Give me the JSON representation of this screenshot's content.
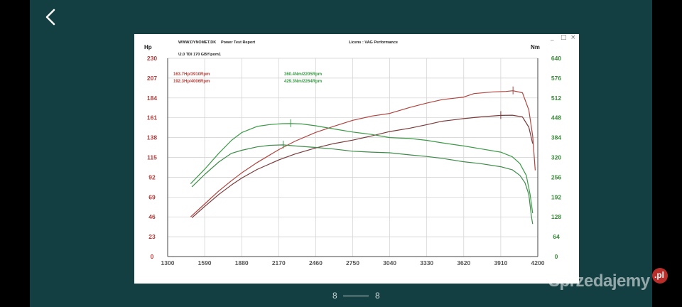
{
  "pager": {
    "current": "8",
    "total": "8"
  },
  "watermark": {
    "brand": "Sprzedajemy",
    "suffix": ".pl"
  },
  "window_controls": {
    "minimize": "_",
    "maximize": "□",
    "close": "×"
  },
  "report": {
    "site": "WWW.DYNOMET.DK",
    "report_title": "Power Test Report",
    "licence": "Licens :  VAG Performance",
    "run_name": "\\2.0 TDI 170 GBY\\pom1"
  },
  "colors": {
    "red": "#b0443e",
    "darkred": "#7a3a3a",
    "green": "#3a9a45",
    "green2": "#3c8c47",
    "axis_left": "#b33a3a",
    "axis_right": "#3a8a3a"
  },
  "chart_data": {
    "type": "line",
    "title": "",
    "xlabel": "",
    "y_left_label": "Hp",
    "y_right_label": "Nm",
    "xlim": [
      1300,
      4200
    ],
    "x_ticks": [
      1300,
      1590,
      1880,
      2170,
      2460,
      2750,
      3040,
      3330,
      3620,
      3910,
      4200
    ],
    "y_left_lim": [
      0,
      230
    ],
    "y_left_ticks": [
      0,
      23,
      46,
      69,
      92,
      115,
      138,
      161,
      184,
      207,
      230
    ],
    "y_right_lim": [
      0,
      640
    ],
    "y_right_ticks": [
      0,
      64,
      128,
      192,
      256,
      320,
      384,
      448,
      512,
      576,
      640
    ],
    "grid": true,
    "annotations": [
      {
        "text": "163.7Hp/3910Rpm",
        "color": "#b0443e"
      },
      {
        "text": "192.3Hp/4006Rpm",
        "color": "#b0443e"
      },
      {
        "text": "360.4Nm/2205Rpm",
        "color": "#3a9a45"
      },
      {
        "text": "429.3Nm/2264Rpm",
        "color": "#3a9a45"
      }
    ],
    "series": [
      {
        "axis": "left",
        "color": "#b0443e",
        "peak_marker": [
          4006,
          192.3
        ],
        "points": [
          [
            1480,
            46
          ],
          [
            1590,
            61
          ],
          [
            1700,
            76
          ],
          [
            1800,
            88
          ],
          [
            1880,
            97
          ],
          [
            2000,
            109
          ],
          [
            2170,
            124
          ],
          [
            2300,
            134
          ],
          [
            2460,
            144
          ],
          [
            2600,
            151
          ],
          [
            2750,
            158
          ],
          [
            2900,
            163
          ],
          [
            3040,
            166
          ],
          [
            3200,
            173
          ],
          [
            3330,
            178
          ],
          [
            3450,
            182
          ],
          [
            3620,
            185
          ],
          [
            3700,
            189
          ],
          [
            3850,
            191
          ],
          [
            3950,
            191.5
          ],
          [
            4006,
            192.3
          ],
          [
            4080,
            190
          ],
          [
            4130,
            170
          ],
          [
            4160,
            140
          ],
          [
            4180,
            100
          ]
        ]
      },
      {
        "axis": "left",
        "color": "#7a3a3a",
        "peak_marker": [
          3910,
          163.7
        ],
        "points": [
          [
            1490,
            45
          ],
          [
            1590,
            58
          ],
          [
            1700,
            72
          ],
          [
            1800,
            83
          ],
          [
            1880,
            91
          ],
          [
            2000,
            101
          ],
          [
            2170,
            112
          ],
          [
            2300,
            119
          ],
          [
            2460,
            126
          ],
          [
            2600,
            131
          ],
          [
            2750,
            135
          ],
          [
            2900,
            140
          ],
          [
            3040,
            145
          ],
          [
            3200,
            149
          ],
          [
            3330,
            153
          ],
          [
            3450,
            157
          ],
          [
            3620,
            160
          ],
          [
            3750,
            162
          ],
          [
            3910,
            163.7
          ],
          [
            4000,
            164
          ],
          [
            4080,
            162
          ],
          [
            4130,
            150
          ],
          [
            4160,
            131
          ]
        ]
      },
      {
        "axis": "right",
        "color": "#3a9a45",
        "peak_marker": [
          2264,
          429.3
        ],
        "points": [
          [
            1480,
            235
          ],
          [
            1590,
            282
          ],
          [
            1700,
            333
          ],
          [
            1800,
            375
          ],
          [
            1880,
            400
          ],
          [
            2000,
            420
          ],
          [
            2100,
            426
          ],
          [
            2200,
            429
          ],
          [
            2264,
            429.3
          ],
          [
            2350,
            428
          ],
          [
            2460,
            422
          ],
          [
            2600,
            412
          ],
          [
            2750,
            402
          ],
          [
            2900,
            394
          ],
          [
            3040,
            384
          ],
          [
            3200,
            381
          ],
          [
            3330,
            375
          ],
          [
            3450,
            367
          ],
          [
            3620,
            357
          ],
          [
            3750,
            348
          ],
          [
            3910,
            337
          ],
          [
            4000,
            322
          ],
          [
            4060,
            300
          ],
          [
            4110,
            262
          ],
          [
            4140,
            200
          ],
          [
            4160,
            140
          ]
        ]
      },
      {
        "axis": "right",
        "color": "#3c8c47",
        "peak_marker": [
          2205,
          360.4
        ],
        "points": [
          [
            1490,
            225
          ],
          [
            1590,
            265
          ],
          [
            1700,
            305
          ],
          [
            1800,
            333
          ],
          [
            1880,
            343
          ],
          [
            2000,
            354
          ],
          [
            2100,
            359
          ],
          [
            2205,
            360.4
          ],
          [
            2300,
            357
          ],
          [
            2460,
            352
          ],
          [
            2600,
            347
          ],
          [
            2750,
            340
          ],
          [
            2900,
            337
          ],
          [
            3040,
            335
          ],
          [
            3200,
            328
          ],
          [
            3330,
            323
          ],
          [
            3450,
            317
          ],
          [
            3620,
            306
          ],
          [
            3750,
            300
          ],
          [
            3910,
            290
          ],
          [
            4000,
            280
          ],
          [
            4060,
            262
          ],
          [
            4100,
            238
          ],
          [
            4130,
            200
          ],
          [
            4150,
            130
          ],
          [
            4160,
            105
          ]
        ]
      }
    ]
  }
}
